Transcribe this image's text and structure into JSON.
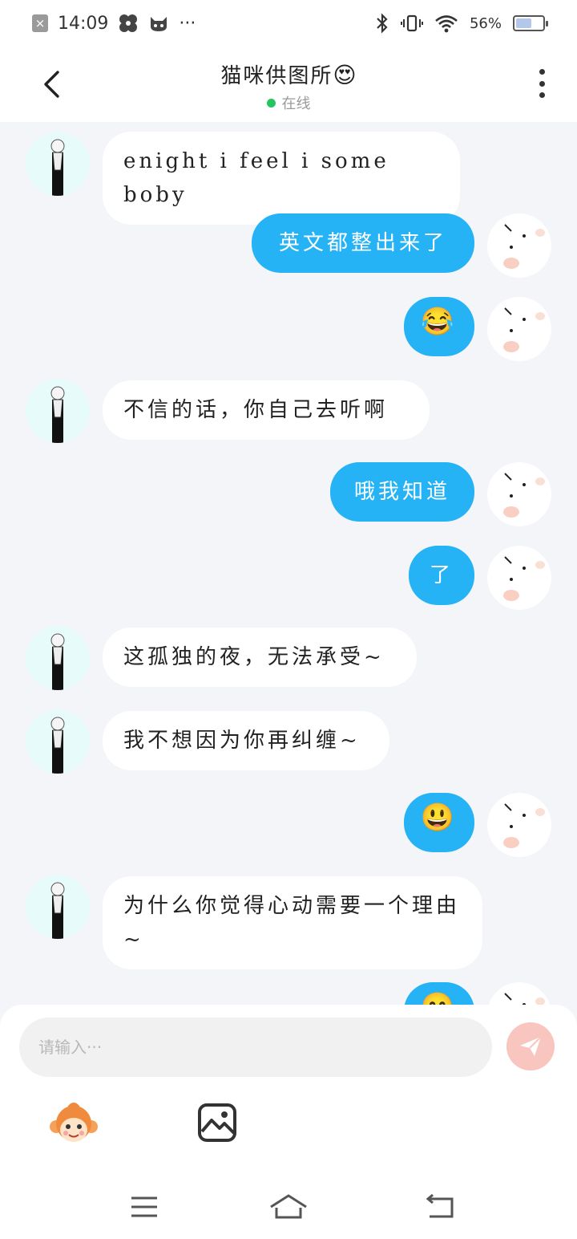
{
  "status_bar": {
    "time": "14:09",
    "dots": "···",
    "battery": "56%",
    "battery_level": 0.56
  },
  "header": {
    "title": "猫咪供图所",
    "title_emoji": "😍",
    "status": "在线"
  },
  "messages": [
    {
      "from": "other",
      "text": "enight i feel i some boby"
    },
    {
      "from": "self",
      "text": "英文都整出来了"
    },
    {
      "from": "self",
      "text": "😂"
    },
    {
      "from": "other",
      "text": "不信的话，你自己去听啊"
    },
    {
      "from": "self",
      "text": "哦我知道"
    },
    {
      "from": "self",
      "text": "了"
    },
    {
      "from": "other",
      "text": "这孤独的夜，无法承受~"
    },
    {
      "from": "other",
      "text": "我不想因为你再纠缠~"
    },
    {
      "from": "self",
      "text": "😃"
    },
    {
      "from": "other",
      "text": "为什么你觉得心动需要一个理由~"
    },
    {
      "from": "self",
      "text": "😊"
    }
  ],
  "input": {
    "placeholder": "请输入···"
  },
  "colors": {
    "self_bubble": "#26b3f5",
    "other_bubble": "#ffffff",
    "background": "#f3f5f8",
    "send_button": "#f9c5bf",
    "online": "#22c55e"
  },
  "icons": {
    "back": "chevron-left-icon",
    "more": "more-vertical-icon",
    "send": "paper-plane-icon",
    "emoji_tool": "monkey-face-icon",
    "image_tool": "image-icon",
    "nav_menu": "menu-icon",
    "nav_home": "home-icon",
    "nav_back": "return-icon"
  }
}
